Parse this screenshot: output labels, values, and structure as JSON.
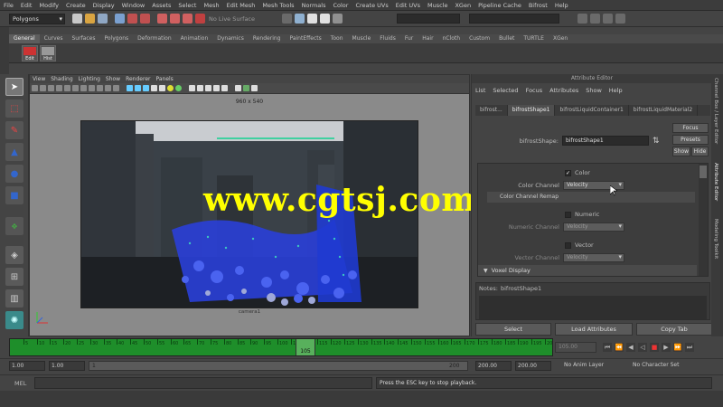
{
  "menubar": {
    "items": [
      "File",
      "Edit",
      "Modify",
      "Create",
      "Display",
      "Window",
      "Assets",
      "Select",
      "Mesh",
      "Edit Mesh",
      "Mesh Tools",
      "Normals",
      "Color",
      "Create UVs",
      "Edit UVs",
      "Muscle",
      "XGen",
      "Pipeline Cache",
      "Bifrost",
      "Help"
    ]
  },
  "statusline": {
    "mode": "Polygons",
    "live_surface": "No Live Surface"
  },
  "shelf": {
    "tabs": [
      "General",
      "Curves",
      "Surfaces",
      "Polygons",
      "Deformation",
      "Animation",
      "Dynamics",
      "Rendering",
      "PaintEffects",
      "Toon",
      "Muscle",
      "Fluids",
      "Fur",
      "Hair",
      "nCloth",
      "Custom",
      "Bullet",
      "TURTLE",
      "XGen"
    ],
    "active_tab": "General",
    "buttons": [
      "Edit",
      "Hist"
    ]
  },
  "viewport": {
    "menu": [
      "View",
      "Shading",
      "Lighting",
      "Show",
      "Renderer",
      "Panels"
    ],
    "resolution": "960 x 540",
    "camera": "camera1"
  },
  "watermark": "www.cgtsj.com",
  "attribute_editor": {
    "title": "Attribute Editor",
    "menu": [
      "List",
      "Selected",
      "Focus",
      "Attributes",
      "Show",
      "Help"
    ],
    "node_tabs": [
      "bifrost...",
      "bifrostShape1",
      "bifrostLiquidContainer1",
      "bifrostLiquidMaterial2"
    ],
    "active_node_tab": "bifrostShape1",
    "shape_label": "bifrostShape:",
    "shape_value": "bifrostShape1",
    "focus_button": "Focus",
    "presets_button": "Presets",
    "show_button": "Show",
    "hide_button": "Hide",
    "color_label": "Color",
    "color_checked": true,
    "color_channel_label": "Color Channel",
    "color_channel_value": "Velocity",
    "remap_label": "Color Channel Remap",
    "numeric_label": "Numeric",
    "numeric_channel_label": "Numeric Channel",
    "numeric_channel_value": "Velocity",
    "vector_label": "Vector",
    "vector_channel_label": "Vector Channel",
    "vector_channel_value": "Velocity",
    "voxel_display_label": "Voxel Display",
    "notes_label": "Notes:",
    "notes_value": "bifrostShape1",
    "buttons": [
      "Select",
      "Load Attributes",
      "Copy Tab"
    ],
    "side_tabs": [
      "Channel Box / Layer Editor",
      "Attribute Editor",
      "Modeling Toolkit"
    ]
  },
  "timeline": {
    "ticks": [
      5,
      10,
      15,
      20,
      25,
      30,
      35,
      40,
      45,
      50,
      55,
      60,
      65,
      70,
      75,
      80,
      85,
      90,
      95,
      100,
      105,
      110,
      115,
      120,
      125,
      130,
      135,
      140,
      145,
      150,
      155,
      160,
      165,
      170,
      175,
      180,
      185,
      190,
      195,
      200
    ],
    "current_frame": "105",
    "frame_field": "105.00"
  },
  "range": {
    "start": "1.00",
    "inner_start": "1.00",
    "range_start_label": "1",
    "range_end_label": "200",
    "inner_end": "200.00",
    "end": "200.00",
    "anim_layer": "No Anim Layer",
    "character_set": "No Character Set"
  },
  "cmdline": {
    "lang": "MEL",
    "help": "Press the ESC key to stop playback."
  },
  "colors": {
    "timeline_green": "#1e8e2a",
    "watermark": "#ffff00"
  }
}
